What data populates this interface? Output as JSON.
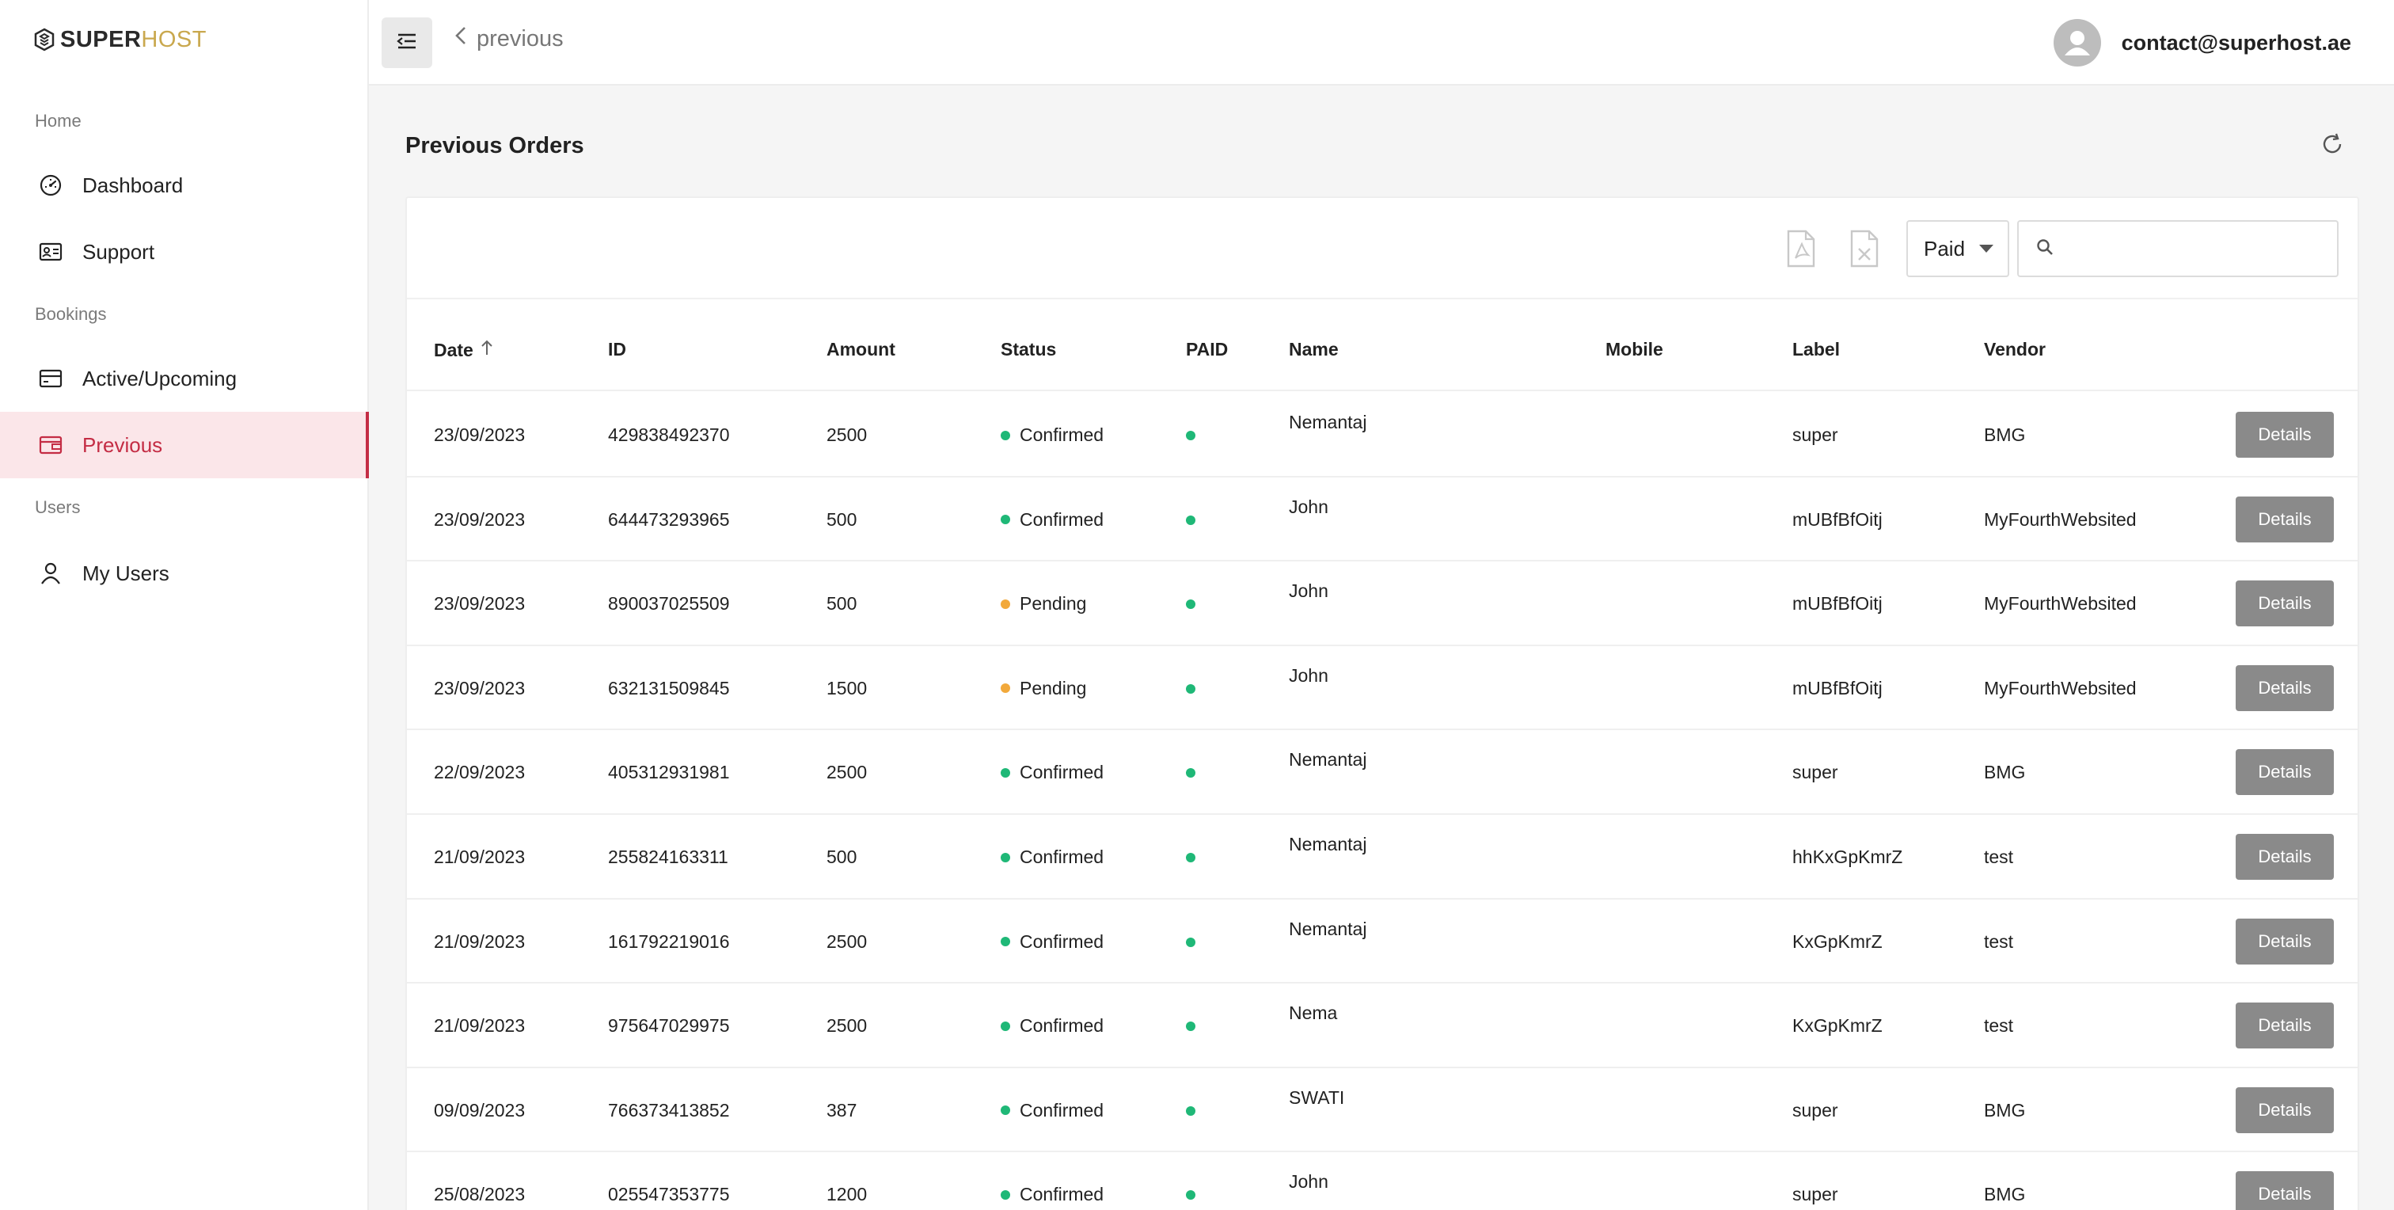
{
  "brand": {
    "super": "SUPER",
    "host": "HOST"
  },
  "sidebar": {
    "sections": {
      "home": "Home",
      "bookings": "Bookings",
      "users": "Users"
    },
    "items": {
      "dashboard": "Dashboard",
      "support": "Support",
      "active": "Active/Upcoming",
      "previous": "Previous",
      "my_users": "My Users"
    },
    "active_item": "previous",
    "accent_color": "#c42c44"
  },
  "topbar": {
    "back_label": "previous",
    "user_email": "contact@superhost.ae"
  },
  "page": {
    "title": "Previous Orders"
  },
  "toolbar": {
    "filter_value": "Paid",
    "search_placeholder": ""
  },
  "table": {
    "headers": {
      "date": "Date",
      "id": "ID",
      "amount": "Amount",
      "status": "Status",
      "paid": "PAID",
      "name": "Name",
      "mobile": "Mobile",
      "label": "Label",
      "vendor": "Vendor"
    },
    "details_label": "Details",
    "status_colors": {
      "Confirmed": "#1fb877",
      "Pending": "#f2a93b"
    },
    "paid_color": "#1fb877",
    "rows": [
      {
        "date": "23/09/2023",
        "id": "429838492370",
        "amount": "2500",
        "status": "Confirmed",
        "name": "Nemantaj",
        "mobile": "",
        "label": "super",
        "vendor": "BMG"
      },
      {
        "date": "23/09/2023",
        "id": "644473293965",
        "amount": "500",
        "status": "Confirmed",
        "name": "John",
        "mobile": "",
        "label": "mUBfBfOitj",
        "vendor": "MyFourthWebsited"
      },
      {
        "date": "23/09/2023",
        "id": "890037025509",
        "amount": "500",
        "status": "Pending",
        "name": "John",
        "mobile": "",
        "label": "mUBfBfOitj",
        "vendor": "MyFourthWebsited"
      },
      {
        "date": "23/09/2023",
        "id": "632131509845",
        "amount": "1500",
        "status": "Pending",
        "name": "John",
        "mobile": "",
        "label": "mUBfBfOitj",
        "vendor": "MyFourthWebsited"
      },
      {
        "date": "22/09/2023",
        "id": "405312931981",
        "amount": "2500",
        "status": "Confirmed",
        "name": "Nemantaj",
        "mobile": "",
        "label": "super",
        "vendor": "BMG"
      },
      {
        "date": "21/09/2023",
        "id": "255824163311",
        "amount": "500",
        "status": "Confirmed",
        "name": "Nemantaj",
        "mobile": "",
        "label": "hhKxGpKmrZ",
        "vendor": "test"
      },
      {
        "date": "21/09/2023",
        "id": "161792219016",
        "amount": "2500",
        "status": "Confirmed",
        "name": "Nemantaj",
        "mobile": "",
        "label": "KxGpKmrZ",
        "vendor": "test"
      },
      {
        "date": "21/09/2023",
        "id": "975647029975",
        "amount": "2500",
        "status": "Confirmed",
        "name": "Nema",
        "mobile": "",
        "label": "KxGpKmrZ",
        "vendor": "test"
      },
      {
        "date": "09/09/2023",
        "id": "766373413852",
        "amount": "387",
        "status": "Confirmed",
        "name": "SWATI",
        "mobile": "",
        "label": "super",
        "vendor": "BMG"
      },
      {
        "date": "25/08/2023",
        "id": "025547353775",
        "amount": "1200",
        "status": "Confirmed",
        "name": "John",
        "mobile": "",
        "label": "super",
        "vendor": "BMG"
      }
    ]
  }
}
